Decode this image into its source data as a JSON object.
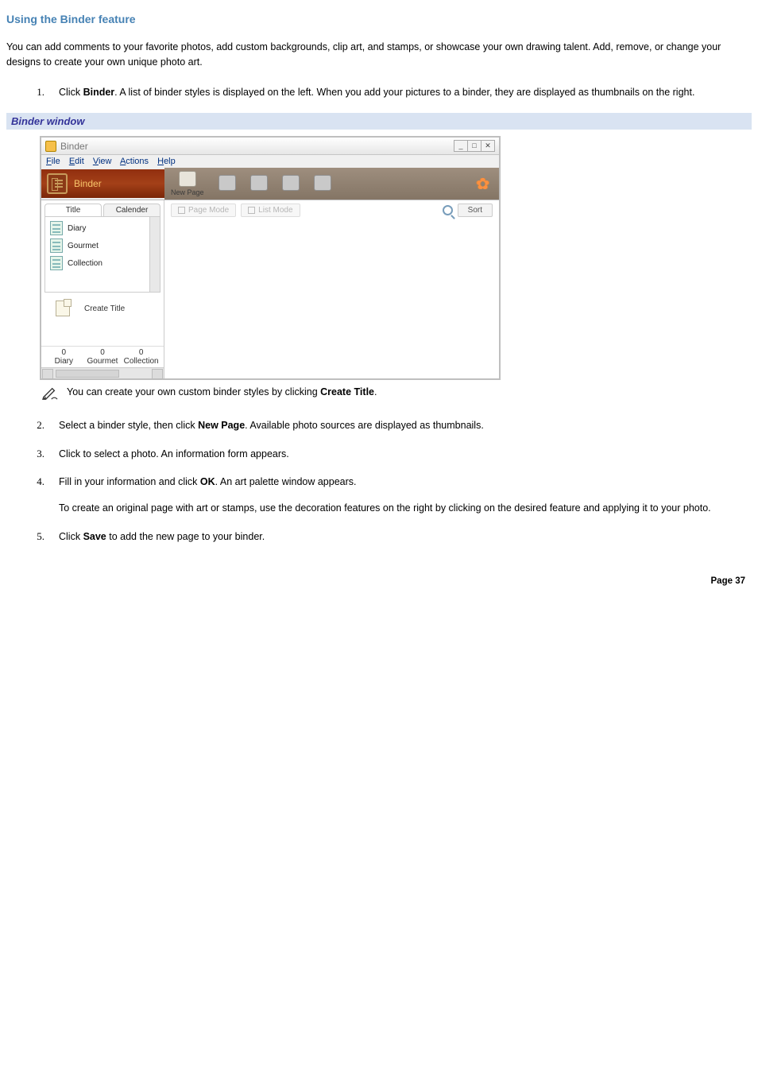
{
  "page_title": "Using the Binder feature",
  "intro": "You can add comments to your favorite photos, add custom backgrounds, clip art, and stamps, or showcase your own drawing talent. Add, remove, or change your designs to create your own unique photo art.",
  "steps": {
    "s1_prefix": "Click ",
    "s1_bold": "Binder",
    "s1_suffix": ". A list of binder styles is displayed on the left. When you add your pictures to a binder, they are displayed as thumbnails on the right.",
    "note_prefix": "You can create your own custom binder styles by clicking ",
    "note_bold": "Create Title",
    "note_suffix": ".",
    "s2_prefix": "Select a binder style, then click ",
    "s2_bold": "New Page",
    "s2_suffix": ". Available photo sources are displayed as thumbnails.",
    "s3": "Click to select a photo. An information form appears.",
    "s4_prefix": "Fill in your information and click ",
    "s4_bold": "OK",
    "s4_suffix": ". An art palette window appears.",
    "s4_para2": "To create an original page with art or stamps, use the decoration features on the right by clicking on the desired feature and applying it to your photo.",
    "s5_prefix": "Click ",
    "s5_bold": "Save",
    "s5_suffix": " to add the new page to your binder."
  },
  "figure_caption": "Binder window",
  "app": {
    "title": "Binder",
    "win_min": "_",
    "win_max": "□",
    "win_close": "✕",
    "menu": {
      "file": "File",
      "edit": "Edit",
      "view": "View",
      "actions": "Actions",
      "help": "Help"
    },
    "toolbar_label": "Binder",
    "tool_new_page": "New Page",
    "sidebar": {
      "tab_title": "Title",
      "tab_calendar": "Calender",
      "items": [
        {
          "label": "Diary"
        },
        {
          "label": "Gourmet"
        },
        {
          "label": "Collection"
        }
      ],
      "create_title": "Create Title",
      "counts": [
        {
          "count": "0",
          "label": "Diary"
        },
        {
          "count": "0",
          "label": "Gourmet"
        },
        {
          "count": "0",
          "label": "Collection"
        }
      ]
    },
    "main": {
      "page_mode": "Page Mode",
      "list_mode": "List Mode",
      "sort": "Sort"
    }
  },
  "footer": {
    "label": "Page ",
    "num": "37"
  }
}
